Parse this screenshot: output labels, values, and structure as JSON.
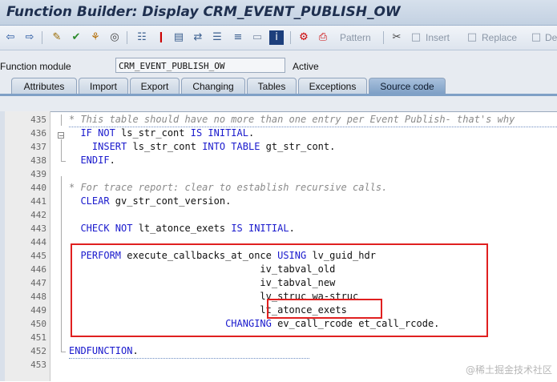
{
  "window": {
    "title": "Function Builder: Display CRM_EVENT_PUBLISH_OW"
  },
  "toolbar": {
    "pattern": "Pattern",
    "insert": "Insert",
    "replace": "Replace",
    "delete": "De"
  },
  "function_module": {
    "label": "Function module",
    "value": "CRM_EVENT_PUBLISH_OW",
    "status": "Active"
  },
  "tabs": [
    {
      "label": "Attributes"
    },
    {
      "label": "Import"
    },
    {
      "label": "Export"
    },
    {
      "label": "Changing"
    },
    {
      "label": "Tables"
    },
    {
      "label": "Exceptions"
    },
    {
      "label": "Source code"
    }
  ],
  "editor": {
    "lines": [
      {
        "num": "435",
        "tokens": [
          [
            "cm",
            "* This table should have no more than one entry per Event Publish- that's why"
          ]
        ]
      },
      {
        "num": "436",
        "tokens": [
          [
            "sp",
            "  "
          ],
          [
            "kw",
            "IF NOT"
          ],
          [
            "tx",
            " ls_str_cont "
          ],
          [
            "kw",
            "IS INITIAL"
          ],
          [
            "tx",
            "."
          ]
        ]
      },
      {
        "num": "437",
        "tokens": [
          [
            "sp",
            "    "
          ],
          [
            "kw",
            "INSERT"
          ],
          [
            "tx",
            " ls_str_cont "
          ],
          [
            "kw",
            "INTO TABLE"
          ],
          [
            "tx",
            " gt_str_cont."
          ]
        ]
      },
      {
        "num": "438",
        "tokens": [
          [
            "sp",
            "  "
          ],
          [
            "kw",
            "ENDIF"
          ],
          [
            "tx",
            "."
          ]
        ]
      },
      {
        "num": "439",
        "tokens": []
      },
      {
        "num": "440",
        "tokens": [
          [
            "cm",
            "* For trace report: clear to establish recursive calls."
          ]
        ]
      },
      {
        "num": "441",
        "tokens": [
          [
            "sp",
            "  "
          ],
          [
            "kw",
            "CLEAR"
          ],
          [
            "tx",
            " gv_str_cont_version."
          ]
        ]
      },
      {
        "num": "442",
        "tokens": []
      },
      {
        "num": "443",
        "tokens": [
          [
            "sp",
            "  "
          ],
          [
            "kw",
            "CHECK NOT"
          ],
          [
            "tx",
            " lt_atonce_exets "
          ],
          [
            "kw",
            "IS INITIAL"
          ],
          [
            "tx",
            "."
          ]
        ]
      },
      {
        "num": "444",
        "tokens": []
      },
      {
        "num": "445",
        "tokens": [
          [
            "sp",
            "  "
          ],
          [
            "kw",
            "PERFORM"
          ],
          [
            "tx",
            " execute_callbacks_at_once "
          ],
          [
            "kw",
            "USING"
          ],
          [
            "tx",
            " lv_guid_hdr"
          ]
        ]
      },
      {
        "num": "446",
        "tokens": [
          [
            "sp",
            "                                 "
          ],
          [
            "tx",
            "iv_tabval_old"
          ]
        ]
      },
      {
        "num": "447",
        "tokens": [
          [
            "sp",
            "                                 "
          ],
          [
            "tx",
            "iv_tabval_new"
          ]
        ]
      },
      {
        "num": "448",
        "tokens": [
          [
            "sp",
            "                                 "
          ],
          [
            "tx",
            "lv_struc wa-struc"
          ]
        ]
      },
      {
        "num": "449",
        "tokens": [
          [
            "sp",
            "                                 "
          ],
          [
            "tx",
            "lt_atonce_exets"
          ]
        ]
      },
      {
        "num": "450",
        "tokens": [
          [
            "sp",
            "                           "
          ],
          [
            "kw",
            "CHANGING"
          ],
          [
            "tx",
            " ev_call_rcode et_call_rcode."
          ]
        ]
      },
      {
        "num": "451",
        "tokens": []
      },
      {
        "num": "452",
        "tokens": [
          [
            "kw",
            "ENDFUNCTION"
          ],
          [
            "tx",
            "."
          ]
        ]
      },
      {
        "num": "453",
        "tokens": []
      }
    ]
  },
  "watermark": "@稀土掘金技术社区",
  "colors": {
    "keyword": "#1a1acd",
    "comment": "#8a8a8a",
    "highlight": "#e02020",
    "active_tab": "#7fa0c6"
  }
}
